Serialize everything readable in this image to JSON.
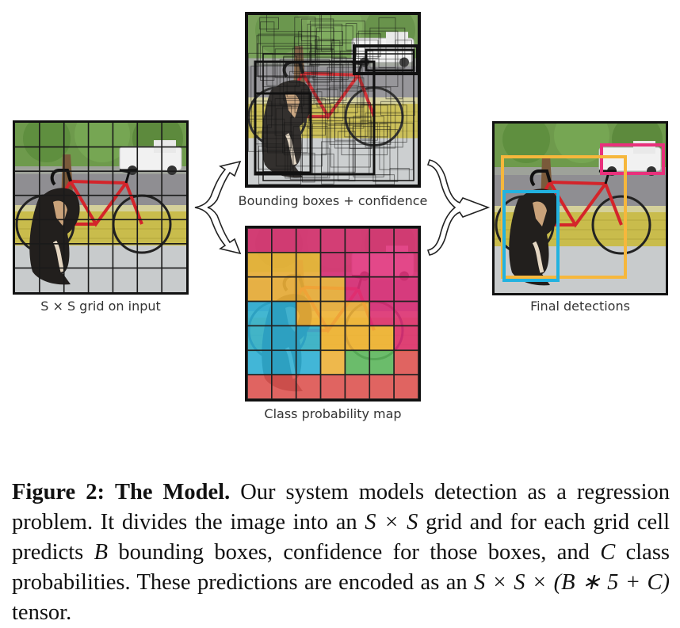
{
  "figure": {
    "panels": {
      "input": {
        "label": "S × S grid on input",
        "grid_size": 7
      },
      "boxes": {
        "label": "Bounding boxes + confidence"
      },
      "class_map": {
        "label": "Class probability map",
        "grid_size": 7,
        "colors": {
          "car": "#e0307a",
          "bicycle": "#f3b53a",
          "dog": "#2fb3d8",
          "grass": "#5db95d",
          "floor": "#e25552"
        },
        "cells": [
          [
            "car",
            "car",
            "car",
            "car",
            "car",
            "car",
            "car"
          ],
          [
            "bicycle",
            "bicycle",
            "bicycle",
            "car",
            "car",
            "car",
            "car"
          ],
          [
            "bicycle",
            "bicycle",
            "bicycle",
            "bicycle",
            "car",
            "car",
            "car"
          ],
          [
            "dog",
            "dog",
            "bicycle",
            "bicycle",
            "bicycle",
            "car",
            "car"
          ],
          [
            "dog",
            "dog",
            "dog",
            "bicycle",
            "bicycle",
            "bicycle",
            "car"
          ],
          [
            "dog",
            "dog",
            "dog",
            "bicycle",
            "grass",
            "grass",
            "floor"
          ],
          [
            "floor",
            "floor",
            "floor",
            "floor",
            "floor",
            "floor",
            "floor"
          ]
        ]
      },
      "final": {
        "label": "Final detections",
        "detections": [
          {
            "class": "car",
            "color": "#e8317c"
          },
          {
            "class": "bicycle",
            "color": "#f6b73c"
          },
          {
            "class": "dog",
            "color": "#22b2e0"
          }
        ]
      }
    },
    "caption": {
      "figure_number": "Figure 2:",
      "title": "The Model.",
      "text_1": " Our system models detection as a regression problem. It divides the image into an ",
      "math_1": "S × S",
      "text_2": " grid and for each grid cell predicts ",
      "math_2": "B",
      "text_3": " bounding boxes, confidence for those boxes, and ",
      "math_3": "C",
      "text_4": " class probabilities.  These predictions are encoded as an ",
      "math_4": "S × S × (B ∗ 5 + C)",
      "text_5": " tensor."
    }
  }
}
